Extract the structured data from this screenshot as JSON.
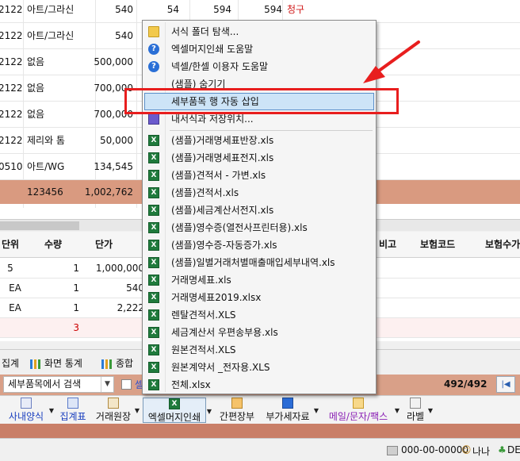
{
  "top_grid": {
    "rows": [
      {
        "code": "2122",
        "item": "아트/그라신",
        "price": "540",
        "qty": "54",
        "amt1": "594",
        "amt2": "594",
        "tag": "청구"
      },
      {
        "code": "2122",
        "item": "아트/그라신",
        "price": "540",
        "qty": "",
        "amt1": "",
        "amt2": "",
        "tag": ""
      },
      {
        "code": "2122",
        "item": "없음",
        "price": "500,000",
        "qty": "",
        "amt1": "",
        "amt2": "",
        "tag": ""
      },
      {
        "code": "2122",
        "item": "없음",
        "price": "700,000",
        "qty": "",
        "amt1": "",
        "amt2": "",
        "tag": ""
      },
      {
        "code": "2122",
        "item": "없음",
        "price": "700,000",
        "qty": "",
        "amt1": "",
        "amt2": "",
        "tag": ""
      },
      {
        "code": "2122",
        "item": "제리와 톰",
        "price": "50,000",
        "qty": "",
        "amt1": "",
        "amt2": "",
        "tag": ""
      },
      {
        "code": "0510",
        "item": "아트/WG",
        "price": "134,545",
        "qty": "",
        "amt1": "",
        "amt2": "",
        "tag": ""
      }
    ],
    "total": {
      "code": "123456",
      "amount": "1,002,762"
    }
  },
  "detail_grid": {
    "headers": [
      "단위",
      "수량",
      "단가",
      "비고",
      "보험코드",
      "보험수가"
    ],
    "rows": [
      {
        "unit": "5",
        "qty": "1",
        "price": "1,000,000"
      },
      {
        "unit": "EA",
        "qty": "1",
        "price": "540"
      },
      {
        "unit": "EA",
        "qty": "1",
        "price": "2,222"
      }
    ],
    "sum_qty": "3"
  },
  "tabs": [
    {
      "label": "집계"
    },
    {
      "label": "화면 통계"
    },
    {
      "label": "종합"
    }
  ],
  "search": {
    "combo_value": "세부품목에서 검색",
    "checkbox_label": "셀",
    "count": "492/492",
    "first_icon": "first-record-icon"
  },
  "toolbar": [
    {
      "label": "사내양식",
      "icon": "document-icon",
      "color": "#1a3fbf"
    },
    {
      "label": "집계표",
      "icon": "report-icon",
      "color": "#1a3fbf"
    },
    {
      "label": "거래원장",
      "icon": "ledger-icon",
      "color": "#111111"
    },
    {
      "label": "엑셀머지인쇄",
      "icon": "excel-icon",
      "color": "#111111"
    },
    {
      "label": "간편장부",
      "icon": "book-icon",
      "color": "#111111"
    },
    {
      "label": "부가세자료",
      "icon": "tax-icon",
      "color": "#111111"
    },
    {
      "label": "메일/문자/팩스",
      "icon": "mail-icon",
      "color": "#8a1fb5"
    },
    {
      "label": "라벨",
      "icon": "label-icon",
      "color": "#111111"
    }
  ],
  "status": {
    "date": "000-00-00000",
    "user": "나나",
    "db": "DE"
  },
  "context_menu": {
    "items": [
      {
        "label": "서식 폴더 탐색...",
        "icon": "folder-icon"
      },
      {
        "label": "엑셀머지인쇄 도움말",
        "icon": "help-icon"
      },
      {
        "label": "넥셀/한셀 이용자 도움말",
        "icon": "help-icon"
      },
      {
        "label": "(샘플) 숨기기",
        "icon": ""
      },
      {
        "label": "세부품목 행 자동 삽입",
        "icon": "",
        "highlighted": true
      },
      {
        "label": "내서식과 저장위치...",
        "icon": "save-icon"
      },
      {
        "label": "(샘플)거래명세표반장.xls",
        "icon": "excel-file-icon"
      },
      {
        "label": "(샘플)거래명세표전지.xls",
        "icon": "excel-file-icon"
      },
      {
        "label": "(샘플)견적서 - 가변.xls",
        "icon": "excel-file-icon"
      },
      {
        "label": "(샘플)견적서.xls",
        "icon": "excel-file-icon"
      },
      {
        "label": "(샘플)세금계산서전지.xls",
        "icon": "excel-file-icon"
      },
      {
        "label": "(샘플)영수증(열전사프린터용).xls",
        "icon": "excel-file-icon"
      },
      {
        "label": "(샘플)영수증-자동증가.xls",
        "icon": "excel-file-icon"
      },
      {
        "label": "(샘플)일별거래처별매출매입세부내역.xls",
        "icon": "excel-file-icon"
      },
      {
        "label": "거래명세표.xls",
        "icon": "excel-file-icon"
      },
      {
        "label": "거래명세표2019.xlsx",
        "icon": "excel-file-icon"
      },
      {
        "label": "렌탈견적서.XLS",
        "icon": "excel-file-icon"
      },
      {
        "label": "세금계산서 우편송부용.xls",
        "icon": "excel-file-icon"
      },
      {
        "label": "원본견적서.XLS",
        "icon": "excel-file-icon"
      },
      {
        "label": "원본계약서 _전자용.XLS",
        "icon": "excel-file-icon"
      },
      {
        "label": "전체.xlsx",
        "icon": "excel-file-icon"
      }
    ]
  },
  "colors": {
    "total_row": "#d99a80",
    "search_bar": "#d9a088",
    "annotation": "#e81e1e",
    "highlight": "#cde4f7",
    "tag_red": "#d01818"
  }
}
